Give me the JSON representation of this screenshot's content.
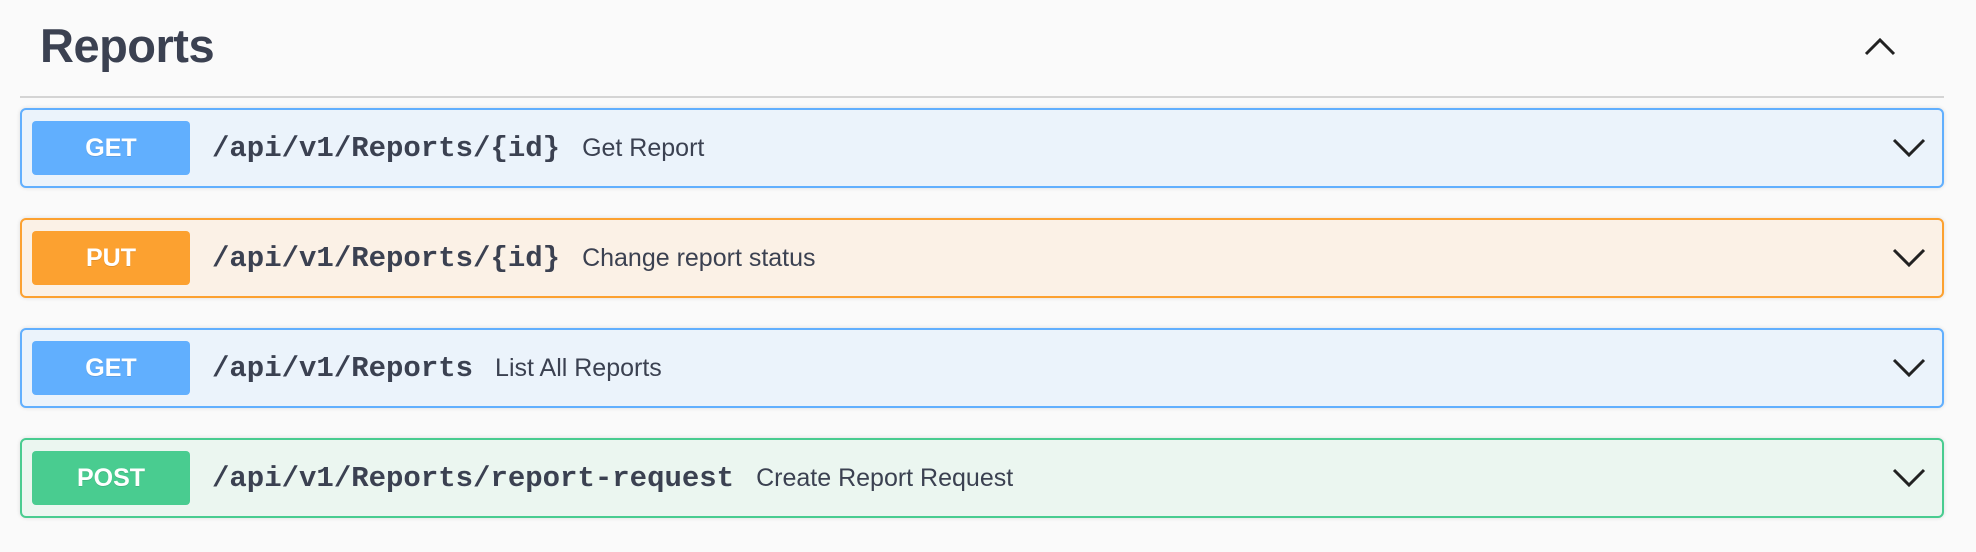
{
  "section": {
    "title": "Reports",
    "toggle_icon": "chevron-up-icon"
  },
  "operations": [
    {
      "method": "GET",
      "path": "/api/v1/Reports/{id}",
      "summary": "Get Report",
      "color": "#61affe"
    },
    {
      "method": "PUT",
      "path": "/api/v1/Reports/{id}",
      "summary": "Change report status",
      "color": "#fca130"
    },
    {
      "method": "GET",
      "path": "/api/v1/Reports",
      "summary": "List All Reports",
      "color": "#61affe"
    },
    {
      "method": "POST",
      "path": "/api/v1/Reports/report-request",
      "summary": "Create Report Request",
      "color": "#49cc90"
    }
  ],
  "icons": {
    "expand": "chevron-down-icon"
  }
}
